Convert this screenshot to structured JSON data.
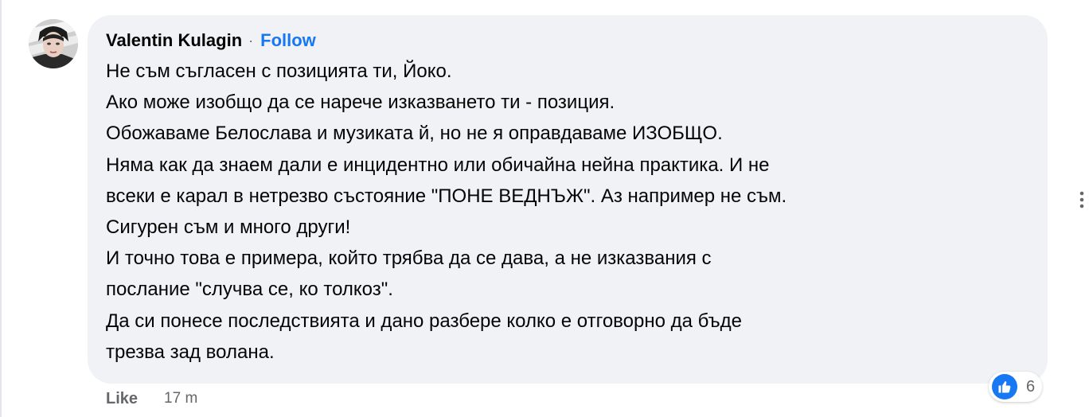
{
  "comment": {
    "author": "Valentin Kulagin",
    "separator": "·",
    "follow_label": "Follow",
    "body_lines": [
      "Не съм съгласен с позицията ти, Йоко.",
      "Ако може изобщо да се нарече изказването ти - позиция.",
      "Обожаваме Белослава и музиката й, но не я оправдаваме ИЗОБЩО.",
      "Няма как да знаем дали е инцидентно или обичайна нейна практика. И не",
      "всеки е карал в нетрезво състояние \"ПОНЕ ВЕДНЪЖ\". Аз например не съм.",
      "Сигурен съм и много други!",
      "И точно това е примера, който трябва да се дава, а не изказвания с",
      "послание \"случва се, ко толкоз\".",
      "Да си понесе последствията и дано разбере колко е отговорно да бъде",
      "трезва зад волана."
    ],
    "reactions": {
      "icon": "thumbs-up-icon",
      "count": "6"
    },
    "actions": {
      "like_label": "Like",
      "timestamp": "17 m"
    }
  },
  "colors": {
    "bubble_bg": "#f0f2f5",
    "link_blue": "#1877f2",
    "secondary_text": "#65676b",
    "primary_text": "#050505"
  },
  "icons": {
    "avatar": "avatar",
    "more": "more-vertical-icon"
  }
}
